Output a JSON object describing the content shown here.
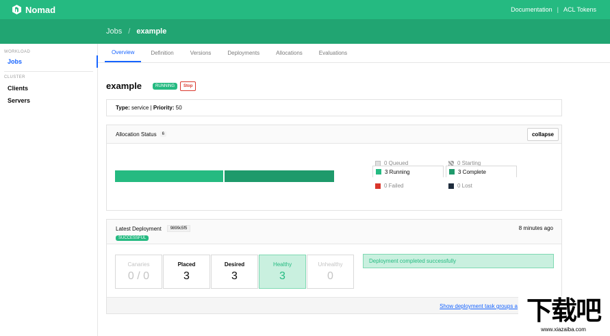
{
  "topbar": {
    "brand": "Nomad",
    "links": [
      "Documentation",
      "ACL Tokens"
    ],
    "sep": "|"
  },
  "breadcrumb": {
    "root": "Jobs",
    "sep": "/",
    "current": "example"
  },
  "sidebar": {
    "workload_heading": "WORKLOAD",
    "workload_items": [
      "Jobs"
    ],
    "cluster_heading": "CLUSTER",
    "cluster_items": [
      "Clients",
      "Servers"
    ]
  },
  "tabs": [
    "Overview",
    "Definition",
    "Versions",
    "Deployments",
    "Allocations",
    "Evaluations"
  ],
  "job": {
    "name": "example",
    "status": "RUNNING",
    "stop_label": "Stop",
    "type_label": "Type:",
    "type": "service",
    "priority_label": "Priority:",
    "priority": "50"
  },
  "allocation": {
    "title": "Allocation Status",
    "count": "6",
    "collapse_label": "collapse",
    "running_fraction": 0.5,
    "complete_fraction": 0.5,
    "legend": {
      "queued": "0 Queued",
      "starting": "0 Starting",
      "running": "3 Running",
      "complete": "3 Complete",
      "failed": "0 Failed",
      "lost": "0 Lost"
    }
  },
  "deployment": {
    "title": "Latest Deployment",
    "id": "9899c5f5",
    "status": "SUCCESSFUL",
    "time": "8 minutes ago",
    "stats": [
      {
        "label": "Canaries",
        "value": "0 / 0"
      },
      {
        "label": "Placed",
        "value": "3"
      },
      {
        "label": "Desired",
        "value": "3"
      },
      {
        "label": "Healthy",
        "value": "3"
      },
      {
        "label": "Unhealthy",
        "value": "0"
      }
    ],
    "message": "Deployment completed successfully",
    "footer_link": "Show deployment task groups a"
  },
  "watermark": {
    "big": "下载吧",
    "small": "www.xiazaiba.com"
  },
  "colors": {
    "primary": "#25ba81",
    "primary_dark": "#21a572",
    "link": "#1563ff",
    "danger": "#d9362b",
    "complete": "#1e9a6b"
  }
}
